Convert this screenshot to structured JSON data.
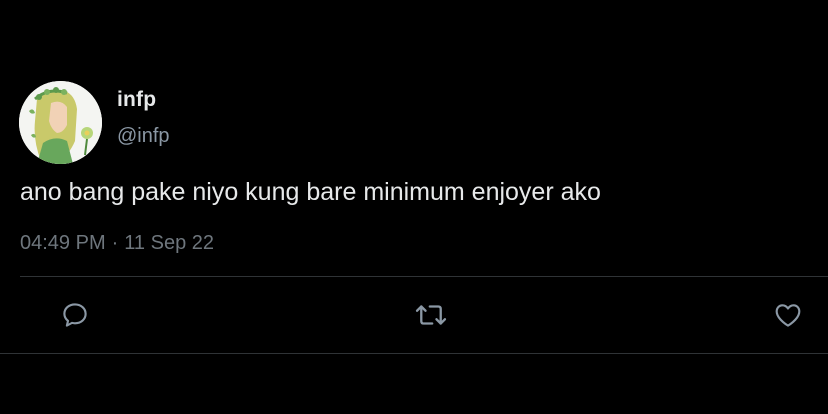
{
  "tweet": {
    "author": {
      "display_name": "infp",
      "handle": "@infp"
    },
    "text": "ano bang pake niyo kung bare minimum enjoyer ako",
    "time": "04:49 PM",
    "separator": "·",
    "date": "11 Sep 22",
    "actions": {
      "reply_icon": "speech-bubble-icon",
      "retweet_icon": "retweet-arrows-icon",
      "like_icon": "heart-icon"
    }
  },
  "colors": {
    "background": "#000000",
    "primary_text": "#e7e9ea",
    "secondary_text": "#8b98a5",
    "icon": "#8b98a5",
    "divider": "#2f3336"
  }
}
